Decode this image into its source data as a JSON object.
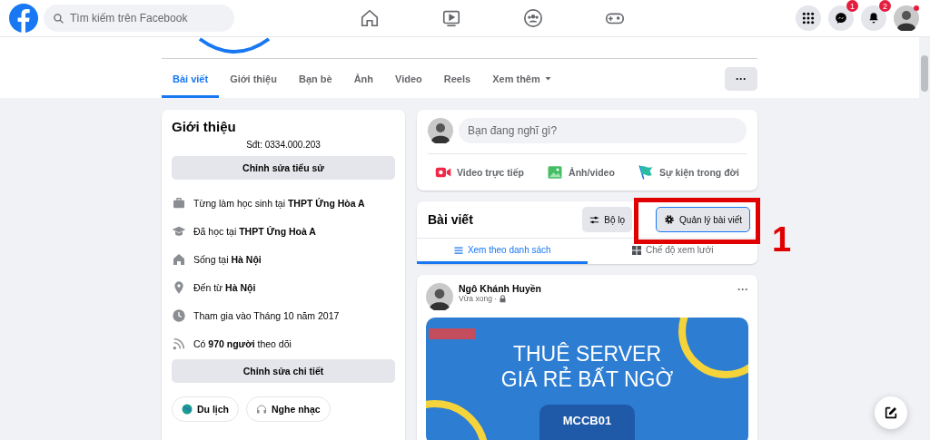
{
  "topbar": {
    "search": {
      "placeholder": "Tìm kiếm trên Facebook"
    },
    "nav_icons": [
      {
        "kind": "home",
        "selected": false
      },
      {
        "kind": "watch",
        "selected": false
      },
      {
        "kind": "groups",
        "selected": false
      },
      {
        "kind": "gaming",
        "selected": false
      }
    ],
    "actions": [
      {
        "kind": "menu"
      },
      {
        "kind": "messenger",
        "badge": "1"
      },
      {
        "kind": "notifications",
        "badge": "2"
      },
      {
        "kind": "account"
      }
    ]
  },
  "profile_tabs": [
    {
      "label": "Bài viết",
      "selected": true
    },
    {
      "label": "Giới thiệu",
      "selected": false
    },
    {
      "label": "Bạn bè",
      "selected": false
    },
    {
      "label": "Ảnh",
      "selected": false
    },
    {
      "label": "Video",
      "selected": false
    },
    {
      "label": "Reels",
      "selected": false
    },
    {
      "label": "Xem thêm",
      "selected": false,
      "dropdown": true
    }
  ],
  "more_button": "···",
  "intro": {
    "title": "Giới thiệu",
    "bio": "Sđt: 0334.000.203",
    "edit_bio": "Chỉnh sửa tiểu sử",
    "details": [
      {
        "kind": "work",
        "text": "Từng làm học sinh tại **THPT Ứng Hòa A**"
      },
      {
        "kind": "school",
        "text": "Đã học tại **THPT Ứng Hoà A**"
      },
      {
        "kind": "home",
        "text": "Sống tại **Hà Nội**"
      },
      {
        "kind": "place",
        "text": "Đến từ **Hà Nội**"
      },
      {
        "kind": "clock",
        "text": "Tham gia vào Tháng 10 năm 2017"
      },
      {
        "kind": "followers",
        "text": "Có **970 người** theo dõi"
      }
    ],
    "edit_details": "Chỉnh sửa chi tiết",
    "hobbies": [
      {
        "kind": "globe",
        "label": "Du lịch"
      },
      {
        "kind": "headphones",
        "label": "Nghe nhạc"
      }
    ]
  },
  "composer": {
    "placeholder": "Bạn đang nghĩ gì?",
    "actions": [
      {
        "kind": "live",
        "label": "Video trực tiếp"
      },
      {
        "kind": "photo",
        "label": "Ảnh/video"
      },
      {
        "kind": "flag",
        "label": "Sự kiện trong đời"
      }
    ]
  },
  "posts_header": {
    "title": "Bài viết",
    "filter": "Bộ lọ",
    "manage": "Quản lý bài viết",
    "views": [
      {
        "kind": "list",
        "label": "Xem theo danh sách",
        "selected": true
      },
      {
        "kind": "grid",
        "label": "Chế độ xem lưới",
        "selected": false
      }
    ]
  },
  "post": {
    "author": "Ngô Khánh Huyền",
    "time": "Vừa xong ·",
    "banner": {
      "line1": "THUÊ SERVER",
      "line2": "GIÁ RẺ BẤT NGỜ",
      "code": "MCCB01"
    }
  },
  "annotation": {
    "label": "1"
  }
}
